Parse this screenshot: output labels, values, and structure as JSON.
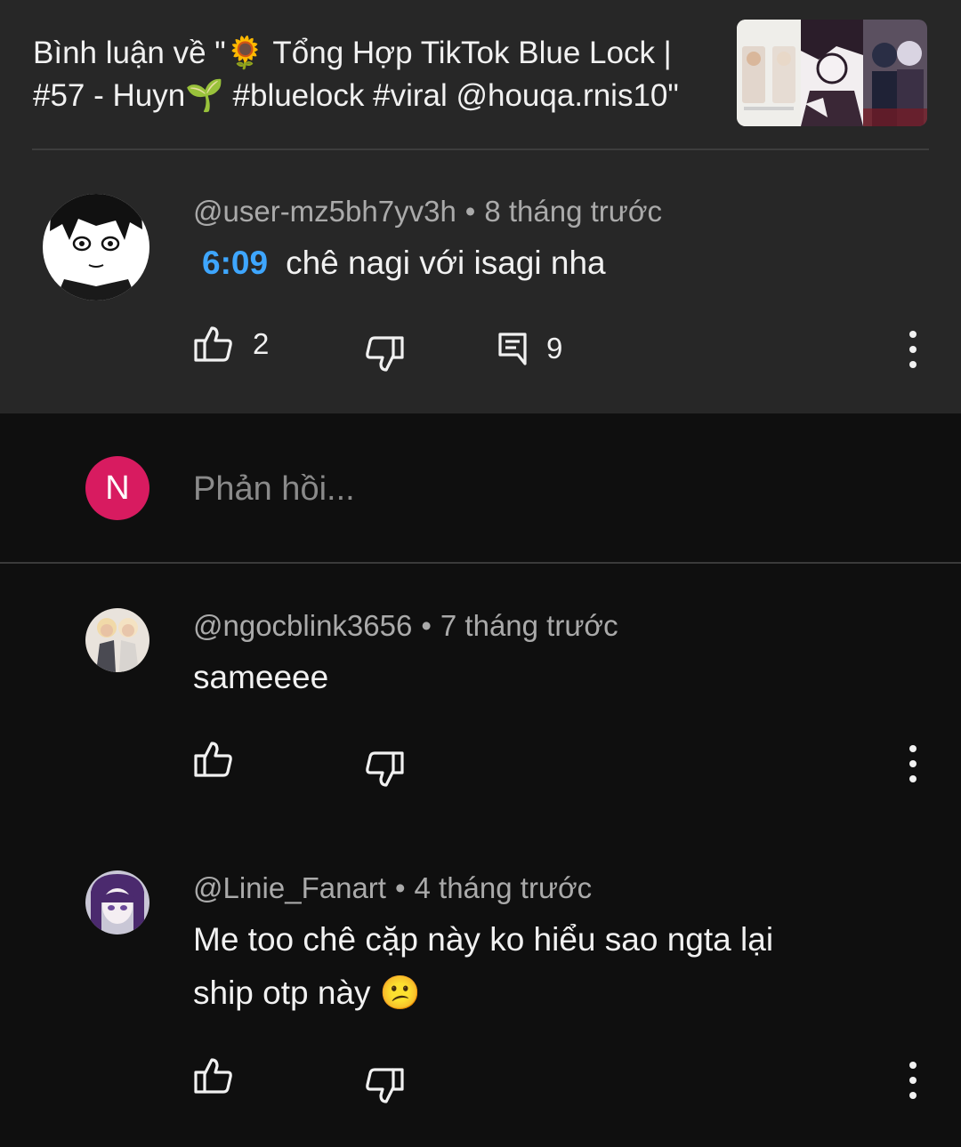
{
  "header": {
    "title": "Bình luận về \"🌻 Tổng Hợp TikTok Blue Lock |\n#57 - Huyn🌱 #bluelock #viral @houqa.rnis10\""
  },
  "main_comment": {
    "author": "@user-mz5bh7yv3h",
    "time": "8 tháng trước",
    "timestamp_link": "6:09",
    "text": "chê nagi với isagi nha",
    "likes": "2",
    "replies": "9"
  },
  "reply_box": {
    "user_initial": "N",
    "placeholder": "Phản hồi..."
  },
  "replies": [
    {
      "author": "@ngocblink3656",
      "time": "7 tháng trước",
      "text": "sameeee"
    },
    {
      "author": "@Linie_Fanart",
      "time": "4 tháng trước",
      "text": "Me too chê cặp này ko hiểu sao ngta lại\nship otp này 😕"
    }
  ],
  "separator": "•",
  "icons": {
    "like": "thumbs-up-icon",
    "dislike": "thumbs-down-icon",
    "reply": "reply-icon",
    "more": "more-vert-icon"
  },
  "colors": {
    "header_bg": "#272727",
    "page_bg": "#0f0f0f",
    "link": "#3ea6ff",
    "avatar_initial_bg": "#d81b60"
  }
}
